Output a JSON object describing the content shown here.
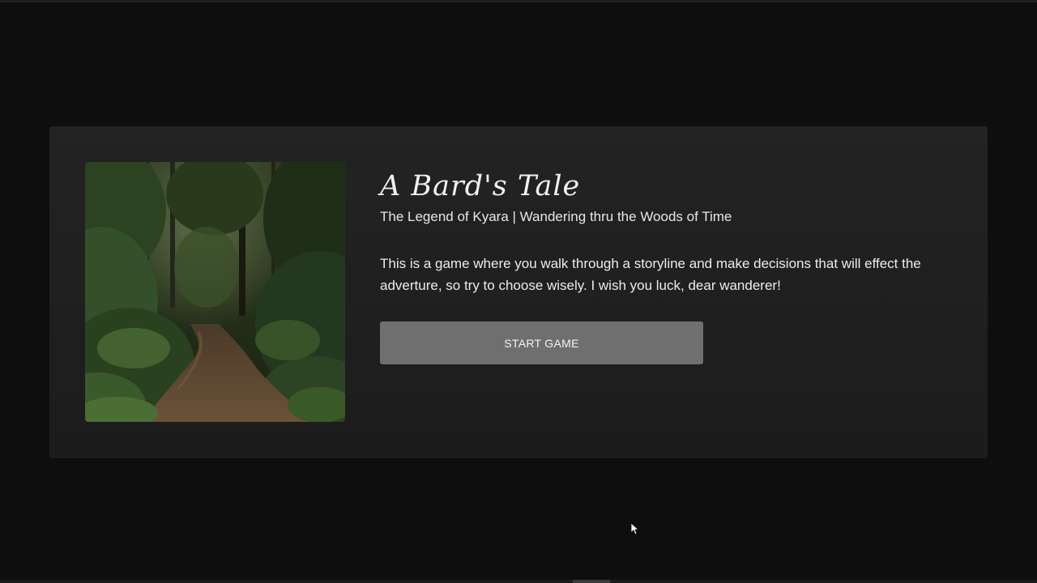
{
  "game": {
    "title": "A Bard's Tale",
    "subtitle": "The Legend of Kyara | Wandering thru the Woods of Time",
    "description": "This is a game where you walk through a storyline and make decisions that will effect the adverture, so try to choose wisely. I wish you luck, dear wanderer!",
    "start_label": "START GAME",
    "image": "forest-path-scene"
  },
  "colors": {
    "background": "#0e0e0e",
    "card": "#202020",
    "button": "#6f6f6f",
    "text": "#f2f2f2"
  }
}
